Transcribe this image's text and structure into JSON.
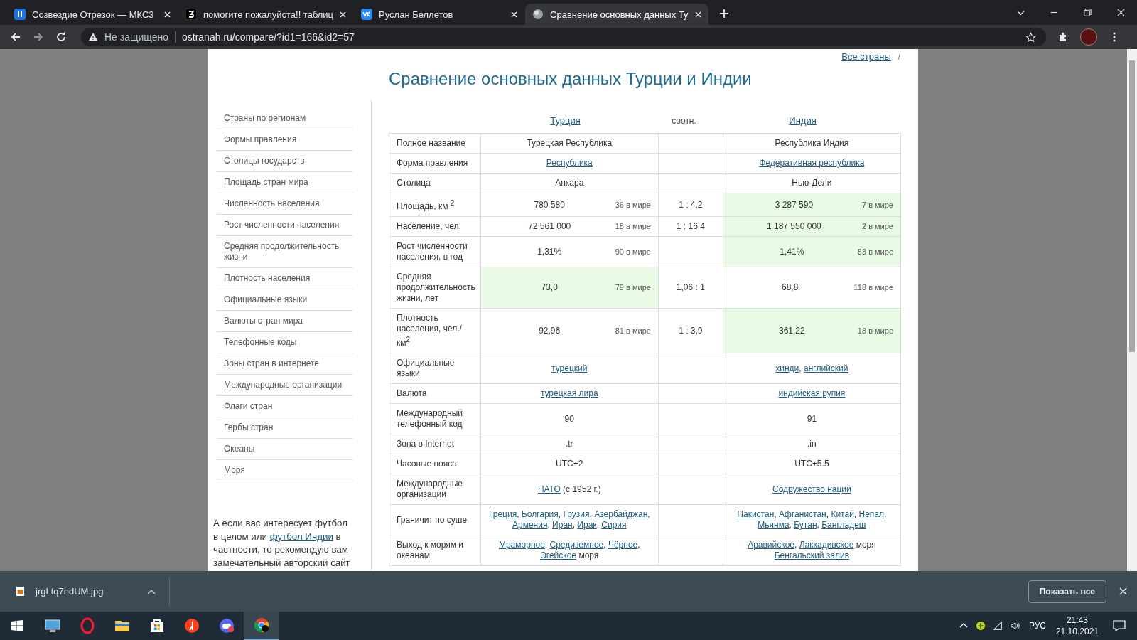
{
  "browser": {
    "tabs": [
      {
        "title": "Созвездие Отрезок — МКС3",
        "selected": false
      },
      {
        "title": "помогите пожалуйста!! таблиц",
        "selected": false
      },
      {
        "title": "Руслан Беллетов",
        "selected": false
      },
      {
        "title": "Сравнение основных данных Ту",
        "selected": true
      }
    ],
    "security": "Не защищено",
    "url": "ostranah.ru/compare/?id1=166&id2=57"
  },
  "page": {
    "breadcrumb": {
      "link": "Все страны",
      "separator": "/"
    },
    "title": "Сравнение основных данных Турции и Индии",
    "sidebar": {
      "items": [
        "Страны по регионам",
        "Формы правления",
        "Столицы государств",
        "Площадь стран мира",
        "Численность населения",
        "Рост численности населения",
        "Средняя продолжительность жизни",
        "Плотность населения",
        "Официальные языки",
        "Валюты стран мира",
        "Телефонные коды",
        "Зоны стран в интернете",
        "Международные организации",
        "Флаги стран",
        "Гербы стран",
        "Океаны",
        "Моря"
      ],
      "note": [
        {
          "text": "А если вас интересует футбол в целом или ",
          "kind": "text"
        },
        {
          "text": "футбол Индии",
          "kind": "link"
        },
        {
          "text": " в частности, то рекомендую вам замечательный авторский сайт",
          "kind": "text"
        }
      ]
    },
    "table": {
      "heading": {
        "country_1": "Турция",
        "ratio": "соотн.",
        "country_2": "Индия"
      },
      "rows": [
        {
          "label": "Полное название",
          "cells": [
            {
              "parts": [
                {
                  "text": "Турецкая Республика",
                  "kind": "text"
                }
              ],
              "highlighted": false
            },
            {
              "parts": [
                {
                  "text": "Республика Индия",
                  "kind": "text"
                }
              ],
              "highlighted": false
            }
          ]
        },
        {
          "label": "Форма правления",
          "cells": [
            {
              "parts": [
                {
                  "text": "Республика",
                  "kind": "link"
                }
              ],
              "highlighted": false
            },
            {
              "parts": [
                {
                  "text": "Федеративная республика",
                  "kind": "link"
                }
              ],
              "highlighted": false
            }
          ]
        },
        {
          "label": "Столица",
          "cells": [
            {
              "parts": [
                {
                  "text": "Анкара",
                  "kind": "text"
                }
              ],
              "highlighted": false
            },
            {
              "parts": [
                {
                  "text": "Нью-Дели",
                  "kind": "text"
                }
              ],
              "highlighted": false
            }
          ]
        },
        {
          "label": "Площадь, км $^{2}$",
          "ratio": "1 : 4,2",
          "cells": [
            {
              "parts": [
                {
                  "text": "780 580",
                  "kind": "text"
                }
              ],
              "rank": "36 в мире",
              "highlighted": false
            },
            {
              "parts": [
                {
                  "text": "3 287 590",
                  "kind": "text"
                }
              ],
              "rank": "7 в мире",
              "highlighted": true
            }
          ]
        },
        {
          "label": "Население, чел.",
          "ratio": "1 : 16,4",
          "cells": [
            {
              "parts": [
                {
                  "text": "72 561 000",
                  "kind": "text"
                }
              ],
              "rank": "18 в мире",
              "highlighted": false
            },
            {
              "parts": [
                {
                  "text": "1 187 550 000",
                  "kind": "text"
                }
              ],
              "rank": "2 в мире",
              "highlighted": true
            }
          ]
        },
        {
          "label": "Рост численности населения, в год",
          "cells": [
            {
              "parts": [
                {
                  "text": "1,31%",
                  "kind": "text"
                }
              ],
              "rank": "90 в мире",
              "highlighted": false
            },
            {
              "parts": [
                {
                  "text": "1,41%",
                  "kind": "text"
                }
              ],
              "rank": "83 в мире",
              "highlighted": true
            }
          ]
        },
        {
          "label": "Средняя продолжительность жизни, лет",
          "ratio": "1,06 : 1",
          "cells": [
            {
              "parts": [
                {
                  "text": "73,0",
                  "kind": "text"
                }
              ],
              "rank": "79 в мире",
              "highlighted": true
            },
            {
              "parts": [
                {
                  "text": "68,8",
                  "kind": "text"
                }
              ],
              "rank": "118 в мире",
              "highlighted": false
            }
          ]
        },
        {
          "label": "Плотность населения, чел./ км$^{2}$",
          "ratio": "1 : 3,9",
          "cells": [
            {
              "parts": [
                {
                  "text": "92,96",
                  "kind": "text"
                }
              ],
              "rank": "81 в мире",
              "highlighted": false
            },
            {
              "parts": [
                {
                  "text": "361,22",
                  "kind": "text"
                }
              ],
              "rank": "18 в мире",
              "highlighted": true
            }
          ]
        },
        {
          "label": "Официальные языки",
          "cells": [
            {
              "parts": [
                {
                  "text": "турецкий",
                  "kind": "link"
                }
              ],
              "highlighted": false
            },
            {
              "parts": [
                {
                  "text": "хинди",
                  "kind": "link"
                },
                {
                  "text": ", ",
                  "kind": "text"
                },
                {
                  "text": "английский",
                  "kind": "link"
                }
              ],
              "highlighted": false
            }
          ]
        },
        {
          "label": "Валюта",
          "cells": [
            {
              "parts": [
                {
                  "text": "турецкая лира",
                  "kind": "link"
                }
              ],
              "highlighted": false
            },
            {
              "parts": [
                {
                  "text": "индийская рупия",
                  "kind": "link"
                }
              ],
              "highlighted": false
            }
          ]
        },
        {
          "label": "Международный телефонный код",
          "cells": [
            {
              "parts": [
                {
                  "text": "90",
                  "kind": "text"
                }
              ],
              "highlighted": false
            },
            {
              "parts": [
                {
                  "text": "91",
                  "kind": "text"
                }
              ],
              "highlighted": false
            }
          ]
        },
        {
          "label": "Зона в Internet",
          "cells": [
            {
              "parts": [
                {
                  "text": ".tr",
                  "kind": "text"
                }
              ],
              "highlighted": false
            },
            {
              "parts": [
                {
                  "text": ".in",
                  "kind": "text"
                }
              ],
              "highlighted": false
            }
          ]
        },
        {
          "label": "Часовые пояса",
          "cells": [
            {
              "parts": [
                {
                  "text": "UTC+2",
                  "kind": "text"
                }
              ],
              "highlighted": false
            },
            {
              "parts": [
                {
                  "text": "UTC+5.5",
                  "kind": "text"
                }
              ],
              "highlighted": false
            }
          ]
        },
        {
          "label": "Международные организации",
          "cells": [
            {
              "parts": [
                {
                  "text": "НАТО",
                  "kind": "link"
                },
                {
                  "text": " (с 1952 г.)",
                  "kind": "text"
                }
              ],
              "highlighted": false
            },
            {
              "parts": [
                {
                  "text": "Содружество наций",
                  "kind": "link"
                }
              ],
              "highlighted": false
            }
          ]
        },
        {
          "label": "Граничит по суше",
          "cells": [
            {
              "parts": [
                {
                  "text": "Греция",
                  "kind": "link"
                },
                {
                  "text": ", ",
                  "kind": "text"
                },
                {
                  "text": "Болгария",
                  "kind": "link"
                },
                {
                  "text": ", ",
                  "kind": "text"
                },
                {
                  "text": "Грузия",
                  "kind": "link"
                },
                {
                  "text": ", ",
                  "kind": "text"
                },
                {
                  "text": "Азербайджан",
                  "kind": "link"
                },
                {
                  "text": ", ",
                  "kind": "text"
                },
                {
                  "text": "Армения",
                  "kind": "link"
                },
                {
                  "text": ", ",
                  "kind": "text"
                },
                {
                  "text": "Иран",
                  "kind": "link"
                },
                {
                  "text": ", ",
                  "kind": "text"
                },
                {
                  "text": "Ирак",
                  "kind": "link"
                },
                {
                  "text": ", ",
                  "kind": "text"
                },
                {
                  "text": "Сирия",
                  "kind": "link"
                }
              ],
              "highlighted": false
            },
            {
              "parts": [
                {
                  "text": "Пакистан",
                  "kind": "link"
                },
                {
                  "text": ", ",
                  "kind": "text"
                },
                {
                  "text": "Афганистан",
                  "kind": "link"
                },
                {
                  "text": ", ",
                  "kind": "text"
                },
                {
                  "text": "Китай",
                  "kind": "link"
                },
                {
                  "text": ", ",
                  "kind": "text"
                },
                {
                  "text": "Непал",
                  "kind": "link"
                },
                {
                  "text": ", ",
                  "kind": "text"
                },
                {
                  "text": "Мьянма",
                  "kind": "link"
                },
                {
                  "text": ", ",
                  "kind": "text"
                },
                {
                  "text": "Бутан",
                  "kind": "link"
                },
                {
                  "text": ", ",
                  "kind": "text"
                },
                {
                  "text": "Бангладеш",
                  "kind": "link"
                }
              ],
              "highlighted": false
            }
          ]
        },
        {
          "label": "Выход к морям и океанам",
          "cells": [
            {
              "parts": [
                {
                  "text": "Мраморное",
                  "kind": "link"
                },
                {
                  "text": ", ",
                  "kind": "text"
                },
                {
                  "text": "Средиземное",
                  "kind": "link"
                },
                {
                  "text": ", ",
                  "kind": "text"
                },
                {
                  "text": "Чёрное",
                  "kind": "link"
                },
                {
                  "text": ", ",
                  "kind": "text"
                },
                {
                  "text": "Эгейское",
                  "kind": "link"
                },
                {
                  "text": " моря",
                  "kind": "text"
                }
              ],
              "highlighted": false
            },
            {
              "parts": [
                {
                  "text": "Аравийское",
                  "kind": "link"
                },
                {
                  "text": ", ",
                  "kind": "text"
                },
                {
                  "text": "Лаккадивское",
                  "kind": "link"
                },
                {
                  "text": " моря ",
                  "kind": "text"
                },
                {
                  "text": "Бенгальский залив",
                  "kind": "link"
                }
              ],
              "highlighted": false
            }
          ]
        }
      ]
    }
  },
  "downloads": {
    "file": "jrgLtq7ndUM.jpg",
    "show_all": "Показать все"
  },
  "taskbar": {
    "apps": [
      {
        "selected": false
      },
      {
        "selected": false
      },
      {
        "selected": false
      },
      {
        "selected": false
      },
      {
        "selected": false
      },
      {
        "selected": false
      },
      {
        "selected": true
      }
    ],
    "language": "РУС",
    "time": "21:43",
    "date": "21.10.2021"
  }
}
